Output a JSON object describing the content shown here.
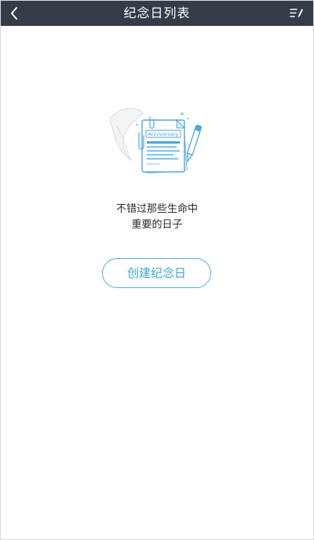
{
  "header": {
    "title": "纪念日列表",
    "back_icon": "chevron-left-icon",
    "edit_icon": "edit-list-icon",
    "background_color": "#343c4a"
  },
  "empty_state": {
    "illustration_icon": "anniversary-document-icon",
    "illustration_label": "Anniversary",
    "message_line1": "不错过那些生命中",
    "message_line2": "重要的日子",
    "create_button_label": "创建纪念日",
    "accent_color": "#4db0de"
  }
}
